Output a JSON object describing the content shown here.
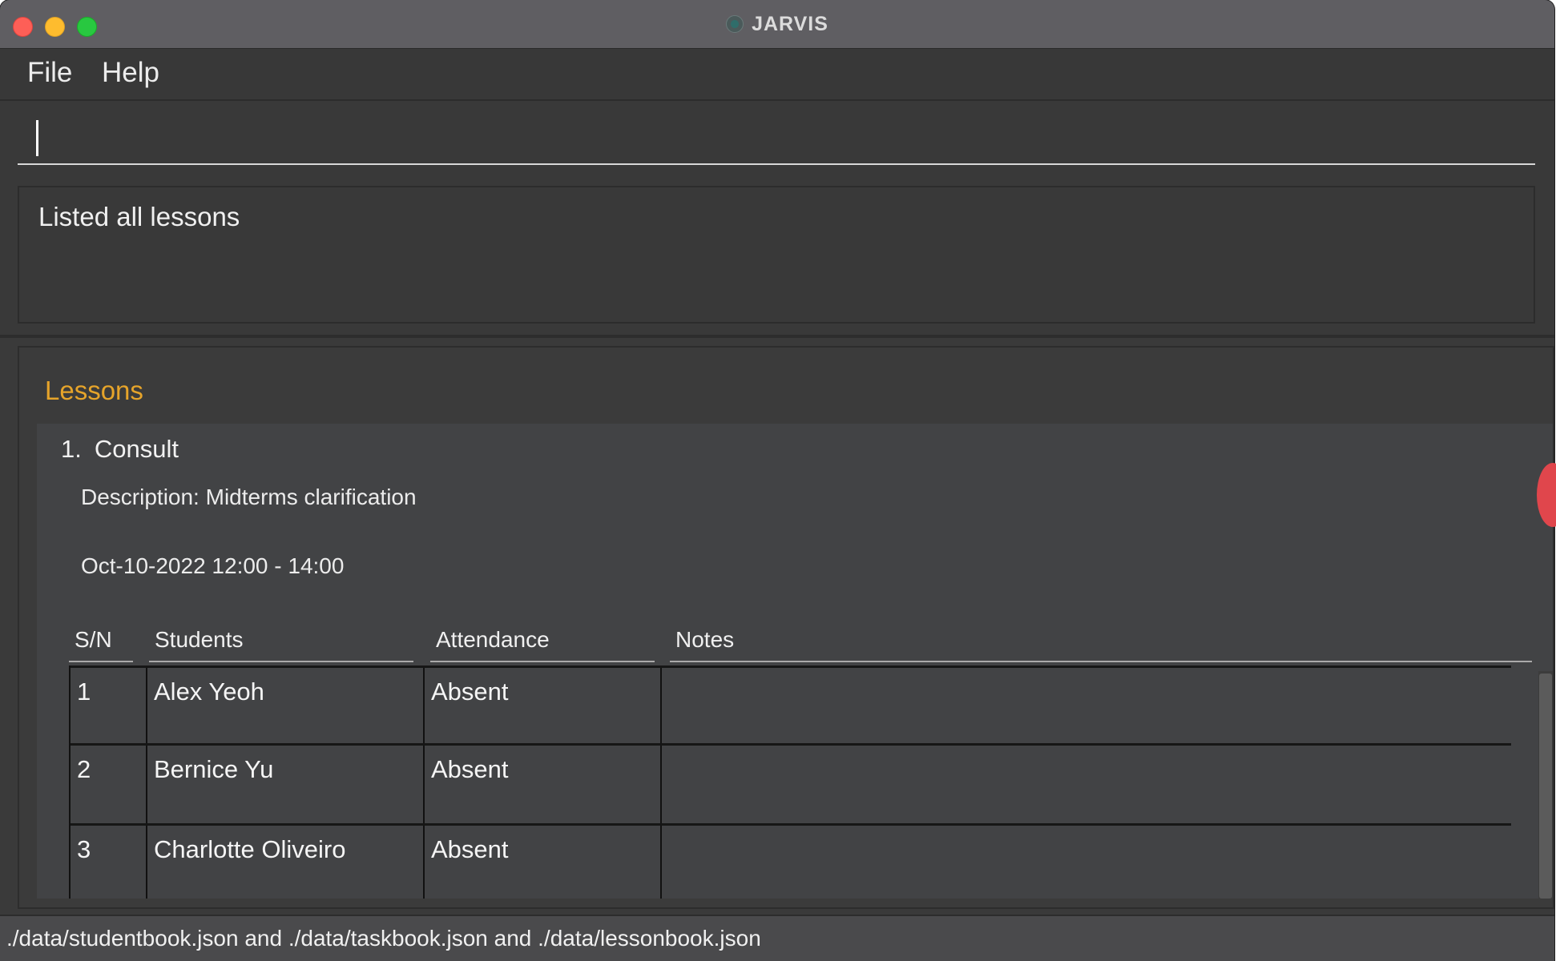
{
  "window": {
    "title": "JARVIS"
  },
  "menu": {
    "file_label": "File",
    "help_label": "Help"
  },
  "command_box": {
    "value": "",
    "placeholder": ""
  },
  "result": {
    "message": "Listed all lessons"
  },
  "lessons_panel": {
    "title": "Lessons",
    "lessons": [
      {
        "index": "1.",
        "name": "Consult",
        "description": "Description: Midterms clarification",
        "time": "Oct-10-2022 12:00 - 14:00",
        "table": {
          "headers": [
            "S/N",
            "Students",
            "Attendance",
            "Notes"
          ],
          "rows": [
            {
              "sn": "1",
              "student": "Alex Yeoh",
              "attendance": "Absent",
              "notes": ""
            },
            {
              "sn": "2",
              "student": "Bernice Yu",
              "attendance": "Absent",
              "notes": ""
            },
            {
              "sn": "3",
              "student": "Charlotte Oliveiro",
              "attendance": "Absent",
              "notes": ""
            }
          ]
        }
      }
    ]
  },
  "status_bar": {
    "text": "./data/studentbook.json and ./data/taskbook.json and ./data/lessonbook.json"
  },
  "colors": {
    "accent_title": "#e6a42a",
    "background": "#3b3c3e",
    "close": "#fe5f57",
    "minimize": "#febc2e",
    "maximize": "#28c840"
  },
  "icons": {
    "app": "jarvis-app-icon"
  }
}
